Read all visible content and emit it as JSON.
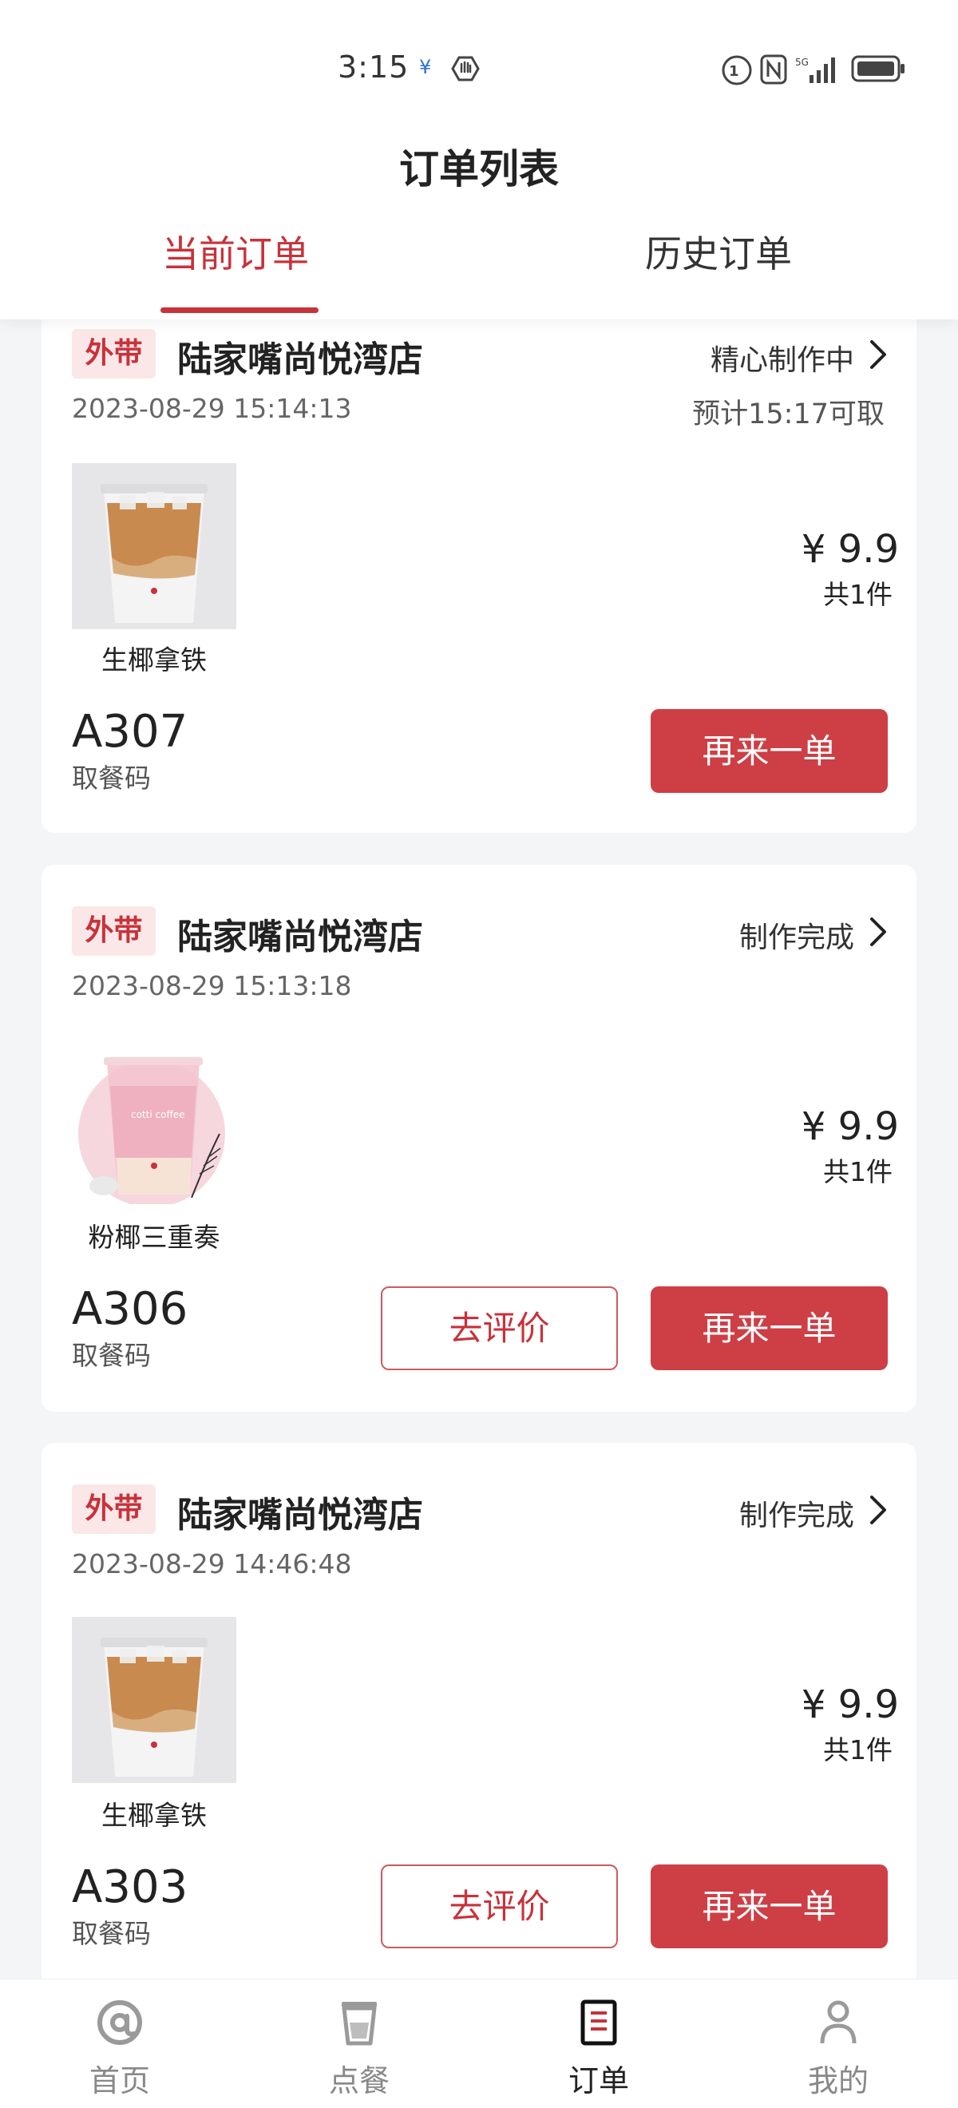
{
  "status_bar": {
    "time": "3:15"
  },
  "header": {
    "title": "订单列表",
    "tabs": [
      {
        "label": "当前订单",
        "active": true
      },
      {
        "label": "历史订单",
        "active": false
      }
    ]
  },
  "orders": [
    {
      "badge": "外带",
      "store": "陆家嘴尚悦湾店",
      "status": "精心制作中",
      "time": "2023-08-29 15:14:13",
      "pickup_estimate": "预计15:17可取",
      "product": {
        "name": "生椰拿铁",
        "image": "coconut-latte-cup"
      },
      "price": "¥ 9.9",
      "quantity": "共1件",
      "pickup_code": "A307",
      "pickup_label": "取餐码",
      "reorder_label": "再来一单"
    },
    {
      "badge": "外带",
      "store": "陆家嘴尚悦湾店",
      "status": "制作完成",
      "time": "2023-08-29 15:13:18",
      "product": {
        "name": "粉椰三重奏",
        "image": "pink-coconut-drink"
      },
      "price": "¥ 9.9",
      "quantity": "共1件",
      "pickup_code": "A306",
      "pickup_label": "取餐码",
      "review_label": "去评价",
      "reorder_label": "再来一单"
    },
    {
      "badge": "外带",
      "store": "陆家嘴尚悦湾店",
      "status": "制作完成",
      "time": "2023-08-29 14:46:48",
      "product": {
        "name": "生椰拿铁",
        "image": "coconut-latte-cup"
      },
      "price": "¥ 9.9",
      "quantity": "共1件",
      "pickup_code": "A303",
      "pickup_label": "取餐码",
      "review_label": "去评价",
      "reorder_label": "再来一单"
    }
  ],
  "bottom_nav": [
    {
      "label": "首页",
      "icon": "at-sign-icon",
      "active": false
    },
    {
      "label": "点餐",
      "icon": "cup-icon",
      "active": false
    },
    {
      "label": "订单",
      "icon": "order-list-icon",
      "active": true
    },
    {
      "label": "我的",
      "icon": "user-icon",
      "active": false
    }
  ],
  "colors": {
    "accent": "#c8323a",
    "button": "#cd3f45",
    "badge_bg": "#fbe7e7",
    "page_bg": "#f4f5f7"
  }
}
